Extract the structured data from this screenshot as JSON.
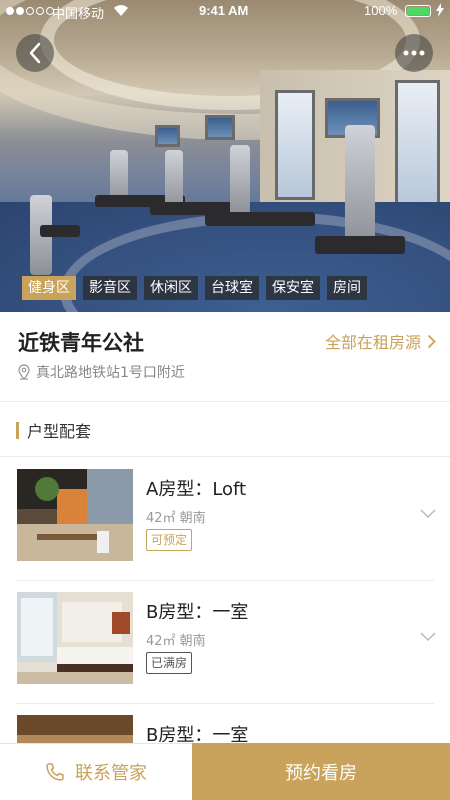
{
  "status_bar": {
    "carrier": "中国移动",
    "time": "9:41 AM",
    "battery_percent": "100%",
    "signal_bars_filled": 2,
    "signal_bars_total": 5
  },
  "hero": {
    "tags": [
      {
        "label": "健身区",
        "active": true
      },
      {
        "label": "影音区",
        "active": false
      },
      {
        "label": "休闲区",
        "active": false
      },
      {
        "label": "台球室",
        "active": false
      },
      {
        "label": "保安室",
        "active": false
      },
      {
        "label": "房间",
        "active": false
      }
    ]
  },
  "info": {
    "title": "近铁青年公社",
    "all_rooms_link": "全部在租房源",
    "address": "真北路地铁站1号口附近"
  },
  "section": {
    "title": "户型配套"
  },
  "rooms": [
    {
      "name": "A房型：Loft",
      "meta": "42㎡ 朝南",
      "badge": "可预定",
      "badge_state": "available"
    },
    {
      "name": "B房型：一室",
      "meta": "42㎡ 朝南",
      "badge": "已满房",
      "badge_state": "full"
    },
    {
      "name": "B房型：一室",
      "meta": "",
      "badge": "",
      "badge_state": ""
    }
  ],
  "bottom_bar": {
    "contact_label": "联系管家",
    "book_label": "预约看房"
  },
  "colors": {
    "accent": "#c9a25b",
    "active_tag": "#c9a25b",
    "battery": "#4cd964"
  }
}
